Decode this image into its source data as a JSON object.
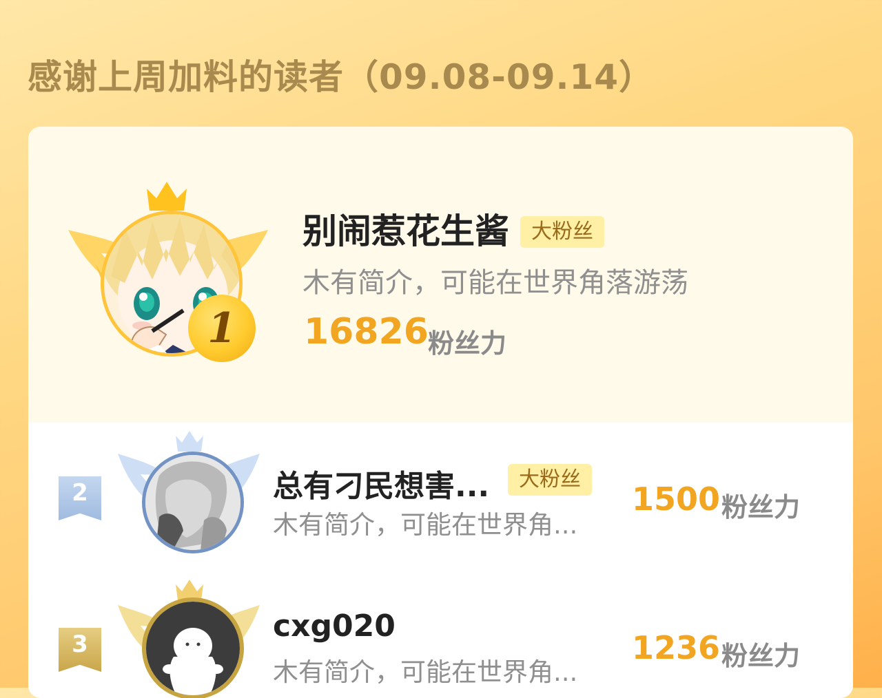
{
  "title": "感谢上周加料的读者（09.08-09.14）",
  "colors": {
    "accent_orange": "#f2a521",
    "badge_bg": "#fff0a6",
    "badge_text": "#9a6a1a",
    "rank2_ribbon": "#a9c2e2",
    "rank3_ribbon": "#d9bd6a",
    "gold_wing": "#ffd253",
    "silver_wing": "#c9dcf4"
  },
  "readers": [
    {
      "rank": "1",
      "name": "别闹惹花生酱",
      "badge": "大粉丝",
      "bio": "木有简介，可能在世界角落游荡",
      "score": "16826",
      "score_unit": "粉丝力",
      "avatar_icon": "anime-girl-avatar"
    },
    {
      "rank": "2",
      "name": "总有刁民想害...",
      "badge": "大粉丝",
      "bio": "木有简介，可能在世界角...",
      "score": "1500",
      "score_unit": "粉丝力",
      "avatar_icon": "sketch-portrait-avatar"
    },
    {
      "rank": "3",
      "name": "cxg020",
      "badge": "",
      "bio": "木有简介，可能在世界角...",
      "score": "1236",
      "score_unit": "粉丝力",
      "avatar_icon": "default-ghost-avatar"
    }
  ]
}
